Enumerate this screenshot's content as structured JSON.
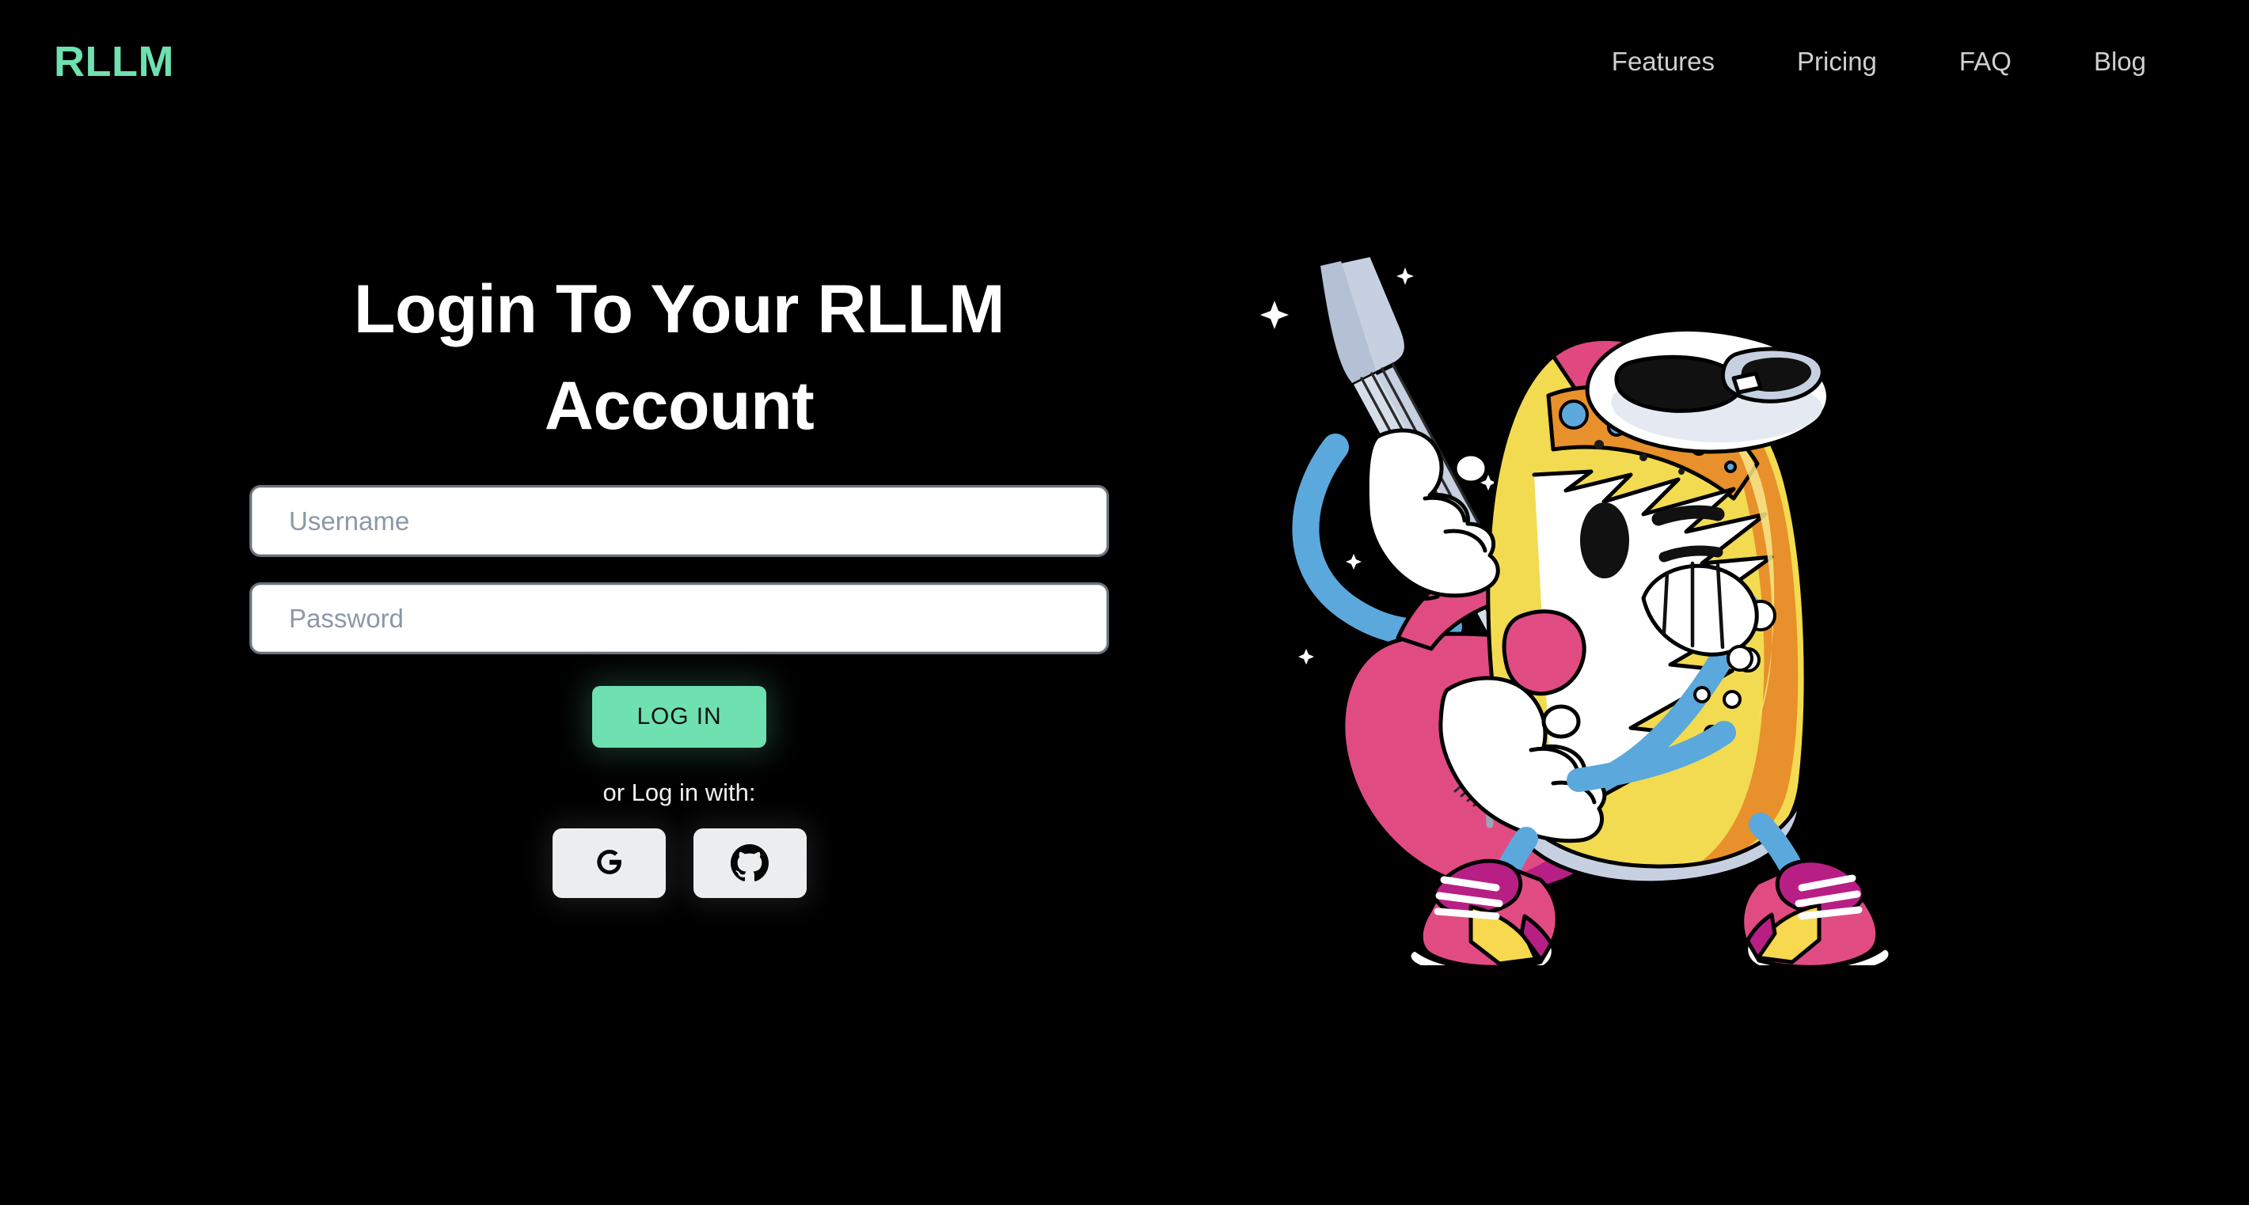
{
  "header": {
    "brand": "RLLM",
    "brand_color": "#6FE0B0",
    "nav": [
      {
        "label": "Features",
        "name": "nav-link-features"
      },
      {
        "label": "Pricing",
        "name": "nav-link-pricing"
      },
      {
        "label": "FAQ",
        "name": "nav-link-faq"
      },
      {
        "label": "Blog",
        "name": "nav-link-blog"
      }
    ]
  },
  "login": {
    "title": "Login To Your RLLM Account",
    "username": {
      "value": "",
      "placeholder": "Username"
    },
    "password": {
      "value": "",
      "placeholder": "Password"
    },
    "submit_label": "LOG IN",
    "alt_label": "or Log in with:",
    "social": [
      {
        "provider": "Google",
        "icon": "google-icon"
      },
      {
        "provider": "GitHub",
        "icon": "github-icon"
      }
    ]
  },
  "illustration": {
    "name": "soda-can-guitarist-mascot",
    "description": "Cartoon soda can character playing a pink electric guitar",
    "palette": {
      "background": "#000000",
      "accent_mint": "#6FE0B0",
      "can_yellow": "#F2DB50",
      "can_orange": "#E8902B",
      "can_pink": "#E0487F",
      "can_magenta": "#B81F84",
      "guitar_pink": "#E04C82",
      "arm_blue": "#5BA8DC",
      "metal_gray": "#C6D0E0",
      "white": "#FFFFFF",
      "shoe_yellow": "#F7D84E"
    }
  }
}
